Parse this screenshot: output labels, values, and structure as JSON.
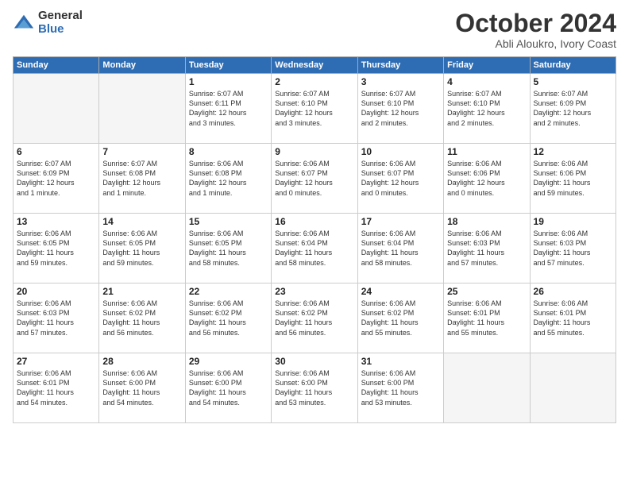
{
  "header": {
    "logo_general": "General",
    "logo_blue": "Blue",
    "month_title": "October 2024",
    "subtitle": "Abli Aloukro, Ivory Coast"
  },
  "days_of_week": [
    "Sunday",
    "Monday",
    "Tuesday",
    "Wednesday",
    "Thursday",
    "Friday",
    "Saturday"
  ],
  "weeks": [
    [
      {
        "day": "",
        "text": ""
      },
      {
        "day": "",
        "text": ""
      },
      {
        "day": "1",
        "text": "Sunrise: 6:07 AM\nSunset: 6:11 PM\nDaylight: 12 hours\nand 3 minutes."
      },
      {
        "day": "2",
        "text": "Sunrise: 6:07 AM\nSunset: 6:10 PM\nDaylight: 12 hours\nand 3 minutes."
      },
      {
        "day": "3",
        "text": "Sunrise: 6:07 AM\nSunset: 6:10 PM\nDaylight: 12 hours\nand 2 minutes."
      },
      {
        "day": "4",
        "text": "Sunrise: 6:07 AM\nSunset: 6:10 PM\nDaylight: 12 hours\nand 2 minutes."
      },
      {
        "day": "5",
        "text": "Sunrise: 6:07 AM\nSunset: 6:09 PM\nDaylight: 12 hours\nand 2 minutes."
      }
    ],
    [
      {
        "day": "6",
        "text": "Sunrise: 6:07 AM\nSunset: 6:09 PM\nDaylight: 12 hours\nand 1 minute."
      },
      {
        "day": "7",
        "text": "Sunrise: 6:07 AM\nSunset: 6:08 PM\nDaylight: 12 hours\nand 1 minute."
      },
      {
        "day": "8",
        "text": "Sunrise: 6:06 AM\nSunset: 6:08 PM\nDaylight: 12 hours\nand 1 minute."
      },
      {
        "day": "9",
        "text": "Sunrise: 6:06 AM\nSunset: 6:07 PM\nDaylight: 12 hours\nand 0 minutes."
      },
      {
        "day": "10",
        "text": "Sunrise: 6:06 AM\nSunset: 6:07 PM\nDaylight: 12 hours\nand 0 minutes."
      },
      {
        "day": "11",
        "text": "Sunrise: 6:06 AM\nSunset: 6:06 PM\nDaylight: 12 hours\nand 0 minutes."
      },
      {
        "day": "12",
        "text": "Sunrise: 6:06 AM\nSunset: 6:06 PM\nDaylight: 11 hours\nand 59 minutes."
      }
    ],
    [
      {
        "day": "13",
        "text": "Sunrise: 6:06 AM\nSunset: 6:05 PM\nDaylight: 11 hours\nand 59 minutes."
      },
      {
        "day": "14",
        "text": "Sunrise: 6:06 AM\nSunset: 6:05 PM\nDaylight: 11 hours\nand 59 minutes."
      },
      {
        "day": "15",
        "text": "Sunrise: 6:06 AM\nSunset: 6:05 PM\nDaylight: 11 hours\nand 58 minutes."
      },
      {
        "day": "16",
        "text": "Sunrise: 6:06 AM\nSunset: 6:04 PM\nDaylight: 11 hours\nand 58 minutes."
      },
      {
        "day": "17",
        "text": "Sunrise: 6:06 AM\nSunset: 6:04 PM\nDaylight: 11 hours\nand 58 minutes."
      },
      {
        "day": "18",
        "text": "Sunrise: 6:06 AM\nSunset: 6:03 PM\nDaylight: 11 hours\nand 57 minutes."
      },
      {
        "day": "19",
        "text": "Sunrise: 6:06 AM\nSunset: 6:03 PM\nDaylight: 11 hours\nand 57 minutes."
      }
    ],
    [
      {
        "day": "20",
        "text": "Sunrise: 6:06 AM\nSunset: 6:03 PM\nDaylight: 11 hours\nand 57 minutes."
      },
      {
        "day": "21",
        "text": "Sunrise: 6:06 AM\nSunset: 6:02 PM\nDaylight: 11 hours\nand 56 minutes."
      },
      {
        "day": "22",
        "text": "Sunrise: 6:06 AM\nSunset: 6:02 PM\nDaylight: 11 hours\nand 56 minutes."
      },
      {
        "day": "23",
        "text": "Sunrise: 6:06 AM\nSunset: 6:02 PM\nDaylight: 11 hours\nand 56 minutes."
      },
      {
        "day": "24",
        "text": "Sunrise: 6:06 AM\nSunset: 6:02 PM\nDaylight: 11 hours\nand 55 minutes."
      },
      {
        "day": "25",
        "text": "Sunrise: 6:06 AM\nSunset: 6:01 PM\nDaylight: 11 hours\nand 55 minutes."
      },
      {
        "day": "26",
        "text": "Sunrise: 6:06 AM\nSunset: 6:01 PM\nDaylight: 11 hours\nand 55 minutes."
      }
    ],
    [
      {
        "day": "27",
        "text": "Sunrise: 6:06 AM\nSunset: 6:01 PM\nDaylight: 11 hours\nand 54 minutes."
      },
      {
        "day": "28",
        "text": "Sunrise: 6:06 AM\nSunset: 6:00 PM\nDaylight: 11 hours\nand 54 minutes."
      },
      {
        "day": "29",
        "text": "Sunrise: 6:06 AM\nSunset: 6:00 PM\nDaylight: 11 hours\nand 54 minutes."
      },
      {
        "day": "30",
        "text": "Sunrise: 6:06 AM\nSunset: 6:00 PM\nDaylight: 11 hours\nand 53 minutes."
      },
      {
        "day": "31",
        "text": "Sunrise: 6:06 AM\nSunset: 6:00 PM\nDaylight: 11 hours\nand 53 minutes."
      },
      {
        "day": "",
        "text": ""
      },
      {
        "day": "",
        "text": ""
      }
    ]
  ]
}
